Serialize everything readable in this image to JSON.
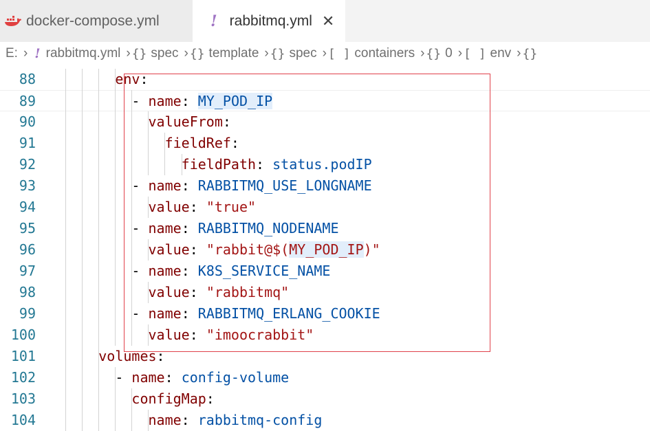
{
  "tabs": [
    {
      "label": "docker-compose.yml",
      "icon": "docker-whale-icon",
      "active": false
    },
    {
      "label": "rabbitmq.yml",
      "icon": "yaml-exclamation-icon",
      "active": true,
      "close": "✕"
    }
  ],
  "breadcrumb": {
    "drive": "E:",
    "items": [
      {
        "icon": "yaml-icon",
        "label": "rabbitmq.yml"
      },
      {
        "icon": "{}",
        "label": "spec"
      },
      {
        "icon": "{}",
        "label": "template"
      },
      {
        "icon": "{}",
        "label": "spec"
      },
      {
        "icon": "[ ]",
        "label": "containers"
      },
      {
        "icon": "{}",
        "label": "0"
      },
      {
        "icon": "[ ]",
        "label": "env"
      },
      {
        "icon": "{}",
        "label": ""
      }
    ]
  },
  "editor": {
    "lines": [
      {
        "num": "88",
        "indent": "        ",
        "parts": [
          [
            "k",
            "env"
          ],
          [
            "p",
            ":"
          ]
        ]
      },
      {
        "num": "89",
        "indent": "          ",
        "parts": [
          [
            "p",
            "- "
          ],
          [
            "k",
            "name"
          ],
          [
            "p",
            ": "
          ],
          [
            "vh",
            "MY_POD_IP"
          ]
        ]
      },
      {
        "num": "90",
        "indent": "            ",
        "parts": [
          [
            "k",
            "valueFrom"
          ],
          [
            "p",
            ":"
          ]
        ]
      },
      {
        "num": "91",
        "indent": "              ",
        "parts": [
          [
            "k",
            "fieldRef"
          ],
          [
            "p",
            ":"
          ]
        ]
      },
      {
        "num": "92",
        "indent": "                ",
        "parts": [
          [
            "k",
            "fieldPath"
          ],
          [
            "p",
            ": "
          ],
          [
            "v",
            "status.podIP"
          ]
        ]
      },
      {
        "num": "93",
        "indent": "          ",
        "parts": [
          [
            "p",
            "- "
          ],
          [
            "k",
            "name"
          ],
          [
            "p",
            ": "
          ],
          [
            "v",
            "RABBITMQ_USE_LONGNAME"
          ]
        ]
      },
      {
        "num": "94",
        "indent": "            ",
        "parts": [
          [
            "k",
            "value"
          ],
          [
            "p",
            ": "
          ],
          [
            "s",
            "\"true\""
          ]
        ]
      },
      {
        "num": "95",
        "indent": "          ",
        "parts": [
          [
            "p",
            "- "
          ],
          [
            "k",
            "name"
          ],
          [
            "p",
            ": "
          ],
          [
            "v",
            "RABBITMQ_NODENAME"
          ]
        ]
      },
      {
        "num": "96",
        "indent": "            ",
        "parts": [
          [
            "k",
            "value"
          ],
          [
            "p",
            ": "
          ],
          [
            "s",
            "\"rabbit@$("
          ],
          [
            "sh",
            "MY_POD_IP"
          ],
          [
            "s",
            ")\""
          ]
        ]
      },
      {
        "num": "97",
        "indent": "          ",
        "parts": [
          [
            "p",
            "- "
          ],
          [
            "k",
            "name"
          ],
          [
            "p",
            ": "
          ],
          [
            "v",
            "K8S_SERVICE_NAME"
          ]
        ]
      },
      {
        "num": "98",
        "indent": "            ",
        "parts": [
          [
            "k",
            "value"
          ],
          [
            "p",
            ": "
          ],
          [
            "s",
            "\"rabbitmq\""
          ]
        ]
      },
      {
        "num": "99",
        "indent": "          ",
        "parts": [
          [
            "p",
            "- "
          ],
          [
            "k",
            "name"
          ],
          [
            "p",
            ": "
          ],
          [
            "v",
            "RABBITMQ_ERLANG_COOKIE"
          ]
        ]
      },
      {
        "num": "100",
        "indent": "            ",
        "parts": [
          [
            "k",
            "value"
          ],
          [
            "p",
            ": "
          ],
          [
            "s",
            "\"imoocrabbit\""
          ]
        ]
      },
      {
        "num": "101",
        "indent": "      ",
        "parts": [
          [
            "k",
            "volumes"
          ],
          [
            "p",
            ":"
          ]
        ]
      },
      {
        "num": "102",
        "indent": "        ",
        "parts": [
          [
            "p",
            "- "
          ],
          [
            "k",
            "name"
          ],
          [
            "p",
            ": "
          ],
          [
            "v",
            "config-volume"
          ]
        ]
      },
      {
        "num": "103",
        "indent": "          ",
        "parts": [
          [
            "k",
            "configMap"
          ],
          [
            "p",
            ":"
          ]
        ]
      },
      {
        "num": "104",
        "indent": "            ",
        "parts": [
          [
            "k",
            "name"
          ],
          [
            "p",
            ": "
          ],
          [
            "v",
            "rabbitmq-config"
          ]
        ]
      }
    ]
  },
  "colors": {
    "key": "#800000",
    "value": "#0451a5",
    "string": "#a31515",
    "line_number": "#237893",
    "highlight": "#e2eefb",
    "selection_box": "#e0404a"
  }
}
